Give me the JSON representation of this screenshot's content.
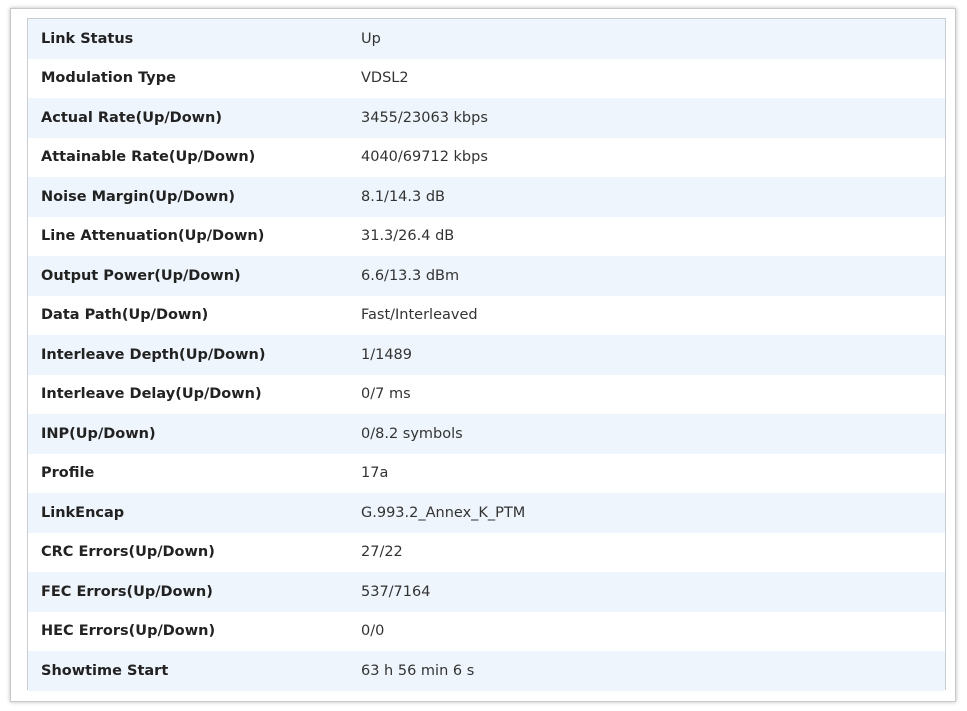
{
  "rows": [
    {
      "label": "Link Status",
      "value": "Up"
    },
    {
      "label": "Modulation Type",
      "value": "VDSL2"
    },
    {
      "label": "Actual Rate(Up/Down)",
      "value": "3455/23063 kbps"
    },
    {
      "label": "Attainable Rate(Up/Down)",
      "value": "4040/69712 kbps"
    },
    {
      "label": "Noise Margin(Up/Down)",
      "value": "8.1/14.3 dB"
    },
    {
      "label": "Line Attenuation(Up/Down)",
      "value": "31.3/26.4 dB"
    },
    {
      "label": "Output Power(Up/Down)",
      "value": "6.6/13.3 dBm"
    },
    {
      "label": "Data Path(Up/Down)",
      "value": "Fast/Interleaved"
    },
    {
      "label": "Interleave Depth(Up/Down)",
      "value": "1/1489"
    },
    {
      "label": "Interleave Delay(Up/Down)",
      "value": "0/7 ms"
    },
    {
      "label": "INP(Up/Down)",
      "value": "0/8.2 symbols"
    },
    {
      "label": "Profile",
      "value": "17a"
    },
    {
      "label": "LinkEncap",
      "value": "G.993.2_Annex_K_PTM"
    },
    {
      "label": "CRC Errors(Up/Down)",
      "value": "27/22"
    },
    {
      "label": "FEC Errors(Up/Down)",
      "value": "537/7164"
    },
    {
      "label": "HEC Errors(Up/Down)",
      "value": "0/0"
    },
    {
      "label": "Showtime Start",
      "value": "63 h 56 min 6 s"
    }
  ]
}
